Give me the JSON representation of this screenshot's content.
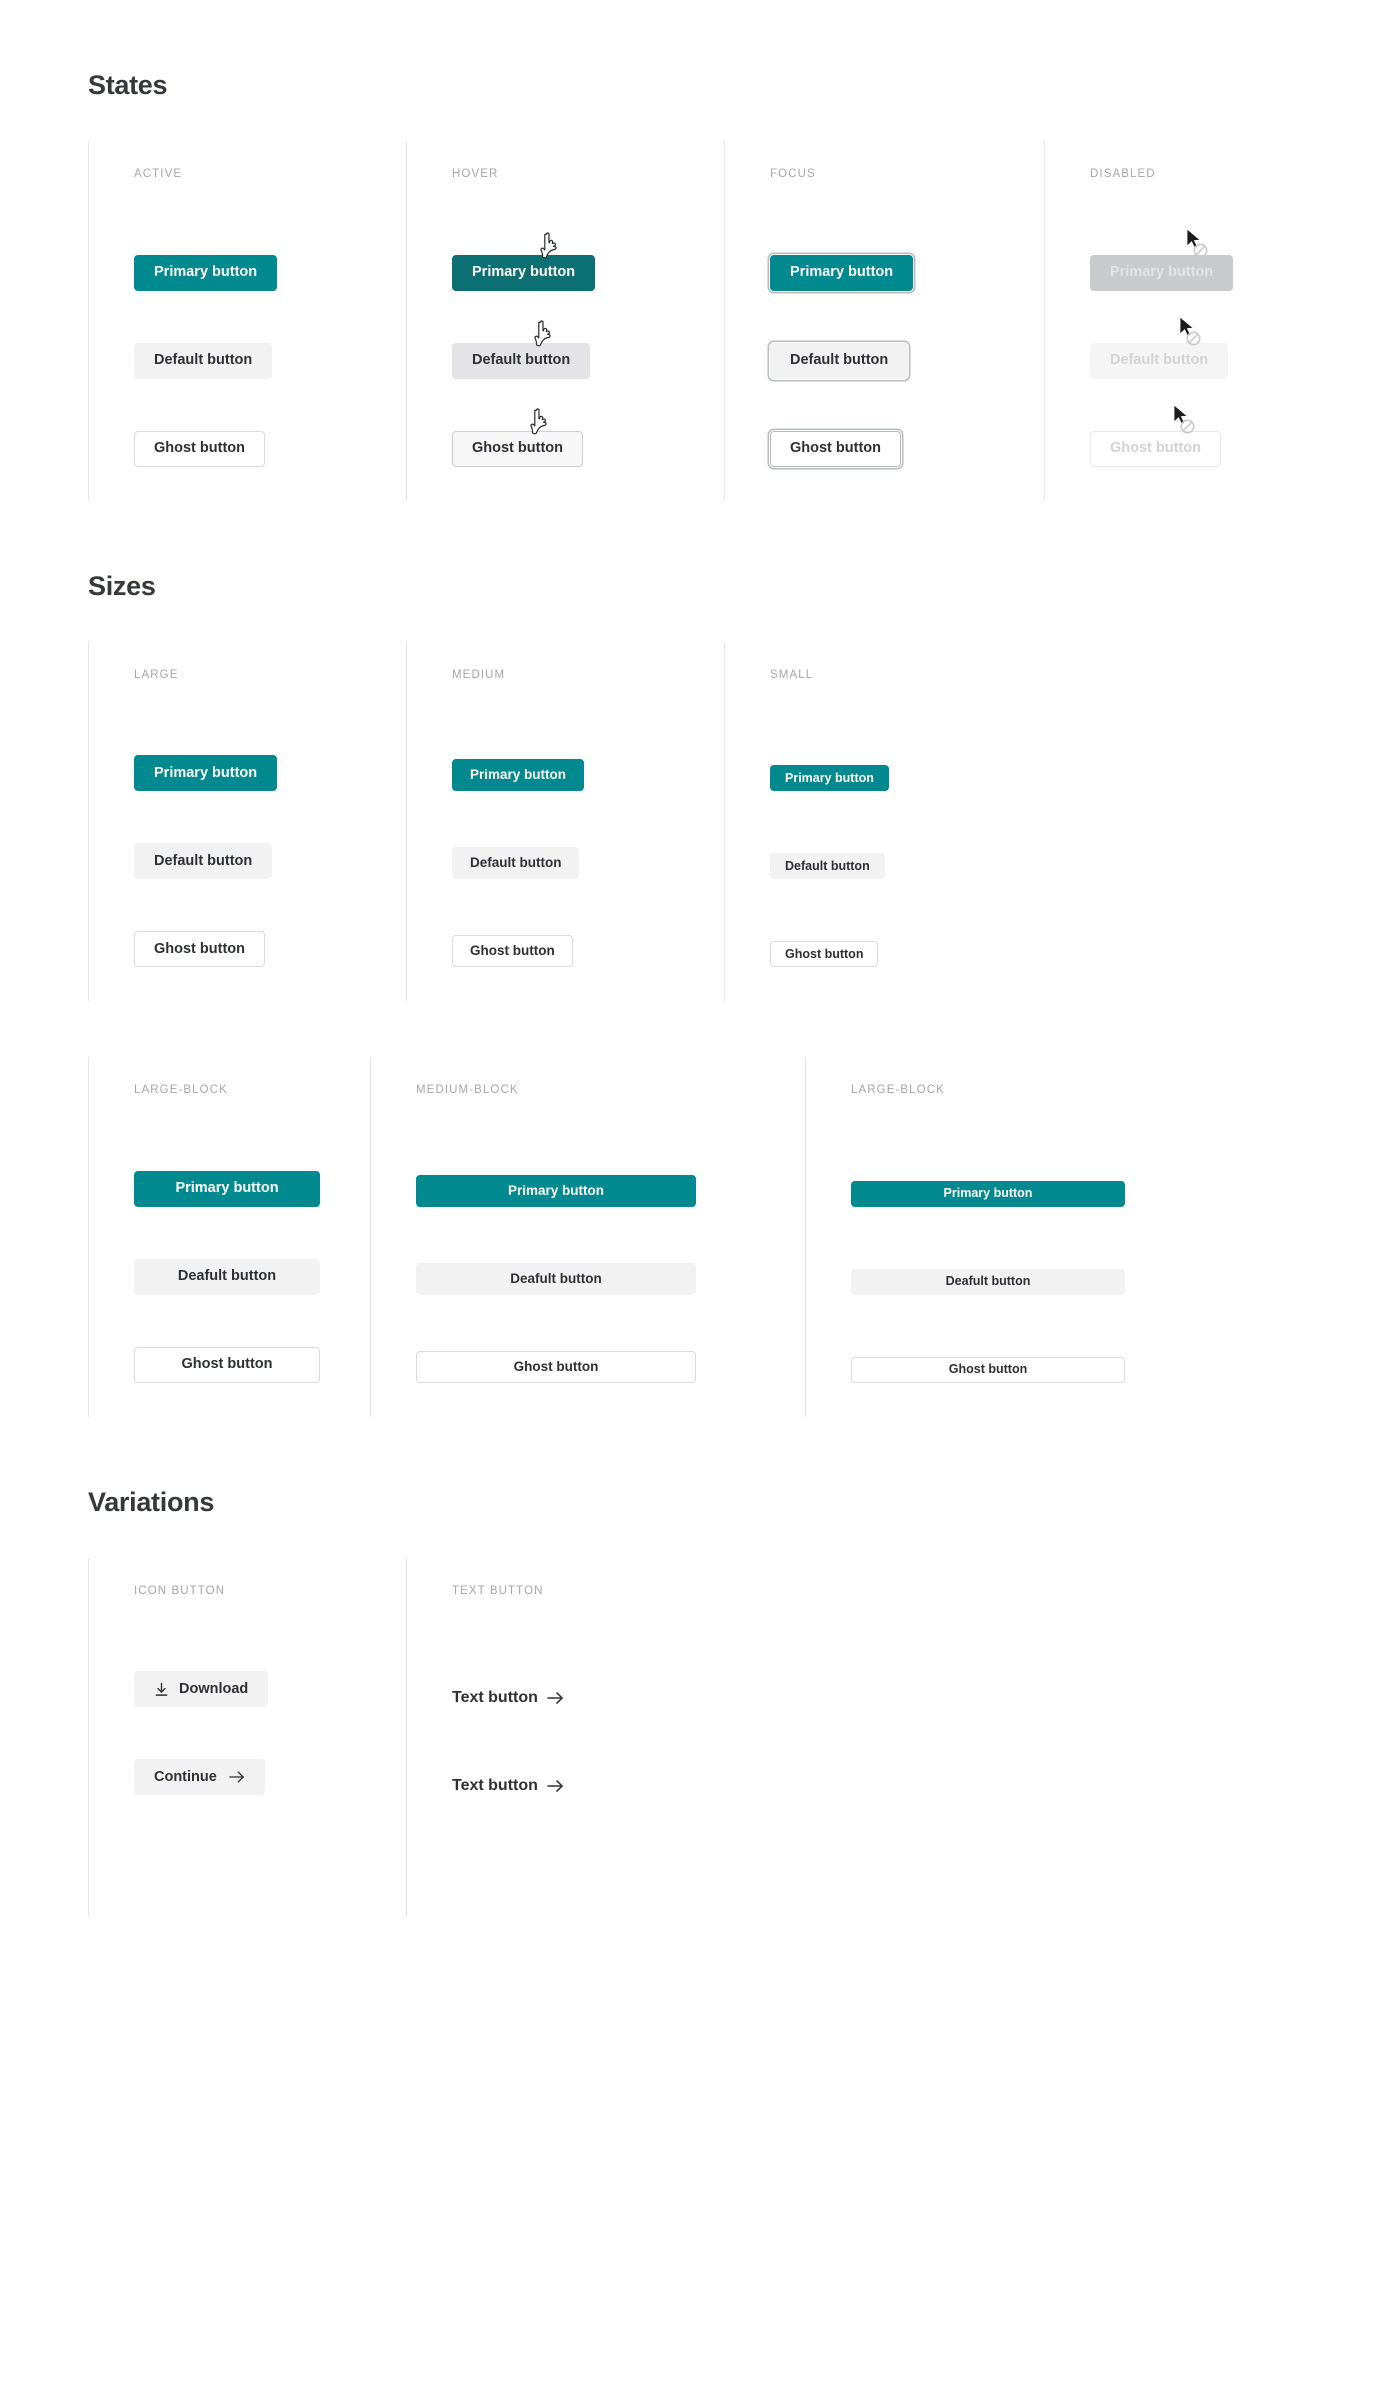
{
  "theme": {
    "primary": "#00898E",
    "primary_hover": "#0C6F72",
    "disabled_bg": "#C9CACC",
    "default_bg": "#F2F2F3",
    "ghost_border": "#DCDCDE",
    "label_color": "#A6A7AB",
    "text_color": "#2F3033"
  },
  "sections": {
    "states": {
      "title": "States",
      "columns": [
        {
          "label": "ACTIVE",
          "state": "active"
        },
        {
          "label": "HOVER",
          "state": "hover"
        },
        {
          "label": "FOCUS",
          "state": "focus"
        },
        {
          "label": "DISABLED",
          "state": "disabled"
        }
      ],
      "buttons": {
        "primary": "Primary button",
        "default": "Default button",
        "ghost": "Ghost button"
      },
      "cursors": {
        "hover": "pointer-hand-cursor",
        "disabled": "arrow-cursor-not-allowed"
      }
    },
    "sizes": {
      "title": "Sizes",
      "columns": [
        {
          "label": "LARGE",
          "size": "lg"
        },
        {
          "label": "MEDIUM",
          "size": "md"
        },
        {
          "label": "SMALL",
          "size": "sm"
        }
      ],
      "buttons": {
        "primary": "Primary button",
        "default": "Default button",
        "ghost": "Ghost button"
      }
    },
    "blocks": {
      "columns": [
        {
          "label": "LARGE-BLOCK",
          "size": "lg"
        },
        {
          "label": "MEDIUM-BLOCK",
          "size": "md"
        },
        {
          "label": "LARGE-BLOCK",
          "size": "sm"
        }
      ],
      "buttons": {
        "primary": "Primary button",
        "default": "Deafult button",
        "ghost": "Ghost button"
      }
    },
    "variations": {
      "title": "Variations",
      "columns": [
        {
          "label": "ICON BUTTON"
        },
        {
          "label": "TEXT BUTTON"
        }
      ],
      "icon_buttons": [
        {
          "label": "Download",
          "icon": "download-icon",
          "icon_position": "before"
        },
        {
          "label": "Continue",
          "icon": "arrow-right-icon",
          "icon_position": "after"
        }
      ],
      "text_buttons": [
        {
          "label": "Text button",
          "icon": "arrow-right-icon"
        },
        {
          "label": "Text button",
          "icon": "arrow-right-icon"
        }
      ]
    }
  }
}
